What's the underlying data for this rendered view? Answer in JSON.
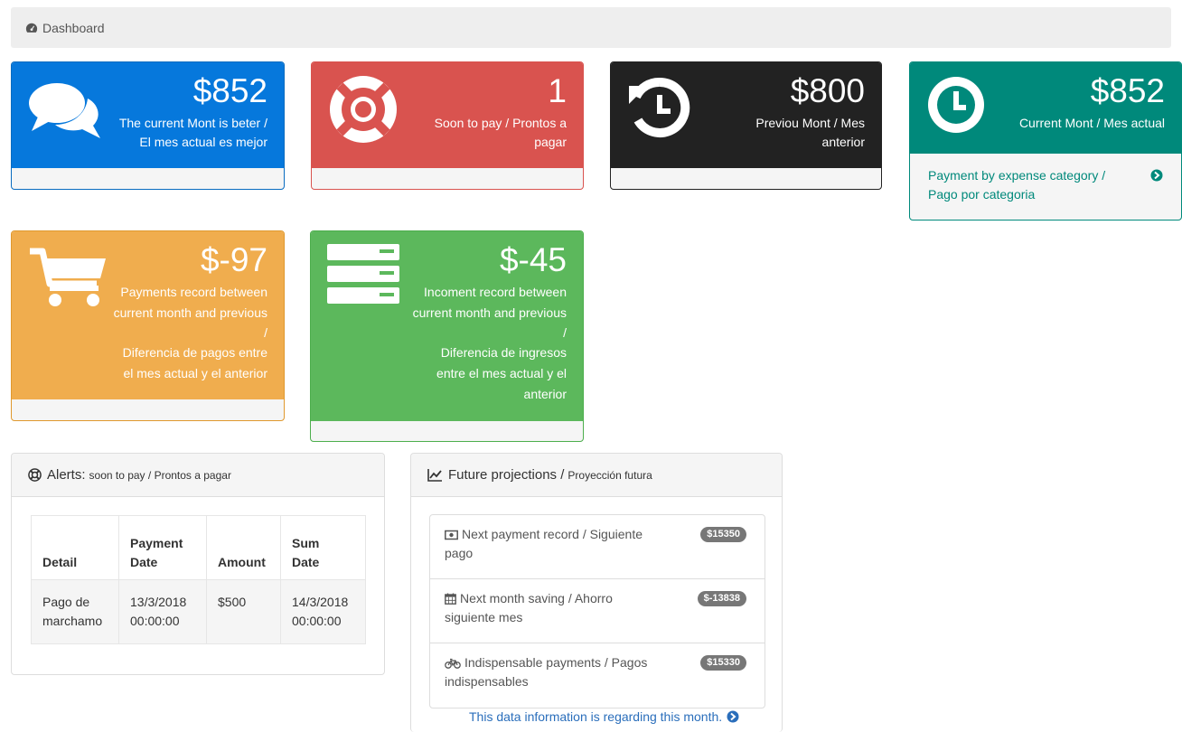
{
  "breadcrumb": {
    "icon": "dashboard-icon",
    "label": "Dashboard"
  },
  "colors": {
    "blue": "#0678dc",
    "red": "#d9534f",
    "dark": "#222222",
    "teal": "#00897b",
    "orange": "#f0ad4e",
    "green": "#5cb85c",
    "link": "#2a6ebb"
  },
  "panels": {
    "current_month": {
      "icon": "comments-icon",
      "value": "$852",
      "line1": "The current Mont is beter /",
      "line2": "El mes actual es mejor"
    },
    "soon_to_pay": {
      "icon": "life-ring-icon",
      "value": "1",
      "line1": "Soon to pay / Prontos a",
      "line2": "pagar"
    },
    "previous_month": {
      "icon": "history-icon",
      "value": "$800",
      "line1": "Previou Mont / Mes",
      "line2": "anterior"
    },
    "current_month_actual": {
      "icon": "clock-icon",
      "value": "$852",
      "line1": "Current Mont / Mes actual",
      "link_line1": "Payment by expense category /",
      "link_line2": "Pago por categoria",
      "arrow_icon": "arrow-circle-right-icon"
    },
    "payments_diff": {
      "icon": "shopping-cart-icon",
      "value": "$-97",
      "line1": "Payments record between",
      "line2": "current month and previous",
      "line3": "/",
      "line4": "Diferencia de pagos entre",
      "line5": "el mes actual y el anterior"
    },
    "income_diff": {
      "icon": "server-icon",
      "value": "$-45",
      "line1": "Incoment record between",
      "line2": "current month and previous",
      "line3": "/",
      "line4": "Diferencia de ingresos",
      "line5": "entre el mes actual y el",
      "line6": "anterior"
    }
  },
  "alerts": {
    "icon": "life-ring-icon",
    "title": "Alerts:",
    "subtitle": "soon to pay / Prontos a pagar",
    "columns": {
      "detail": "Detail",
      "payment_date_1": "Payment",
      "payment_date_2": "Date",
      "amount": "Amount",
      "sum_date_1": "Sum",
      "sum_date_2": "Date"
    },
    "rows": [
      {
        "detail_1": "Pago de",
        "detail_2": "marchamo",
        "payment_date_1": "13/3/2018",
        "payment_date_2": "00:00:00",
        "amount": "$500",
        "sum_date_1": "14/3/2018",
        "sum_date_2": "00:00:00"
      }
    ]
  },
  "projections": {
    "icon": "line-chart-icon",
    "title": "Future projections /",
    "subtitle": "Proyección futura",
    "items": [
      {
        "icon": "money-icon",
        "line1": "Next payment record / Siguiente",
        "line2": "pago",
        "badge": "$15350"
      },
      {
        "icon": "calendar-icon",
        "line1": "Next month saving / Ahorro",
        "line2": "siguiente mes",
        "badge": "$-13838"
      },
      {
        "icon": "bicycle-icon",
        "line1": "Indispensable payments / Pagos",
        "line2": "indispensables",
        "badge": "$15330"
      }
    ],
    "note": "This data information is regarding this month.",
    "note_icon": "arrow-circle-right-icon"
  }
}
